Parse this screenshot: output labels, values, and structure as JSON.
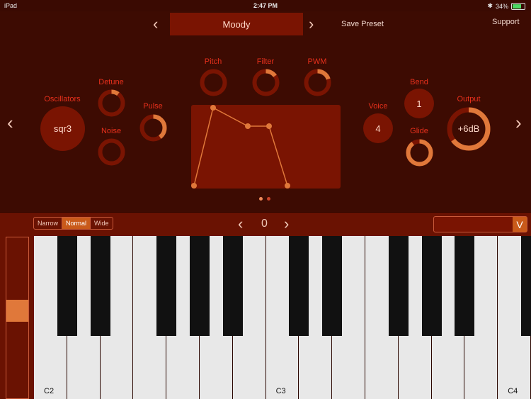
{
  "status": {
    "device": "iPad",
    "time": "2:47 PM",
    "battery": "34%"
  },
  "preset": {
    "name": "Moody",
    "prev_icon": "chevron-left-icon",
    "next_icon": "chevron-right-icon",
    "save_label": "Save Preset"
  },
  "support_label": "Support",
  "controls": {
    "oscillators": {
      "label": "Oscillators",
      "value": "sqr3"
    },
    "detune": {
      "label": "Detune",
      "level": 0.1
    },
    "noise": {
      "label": "Noise",
      "level": 0
    },
    "pulse": {
      "label": "Pulse",
      "level": 0.4
    },
    "pitch": {
      "label": "Pitch",
      "level": 0
    },
    "filter": {
      "label": "Filter",
      "level": 0.15
    },
    "pwm": {
      "label": "PWM",
      "level": 0.2
    },
    "voice": {
      "label": "Voice",
      "value": "4"
    },
    "bend": {
      "label": "Bend",
      "value": "1"
    },
    "glide": {
      "label": "Glide",
      "level": 0.9
    },
    "output": {
      "label": "Output",
      "value": "+6dB",
      "level": 0.65
    }
  },
  "keyboard": {
    "width_modes": [
      "Narrow",
      "Normal",
      "Wide"
    ],
    "selected_mode": "Normal",
    "octave_shift": "0",
    "dropdown_icon": "V",
    "note_labels": [
      "C2",
      "C3",
      "C4"
    ],
    "slider_level": 0.55
  },
  "colors": {
    "accent": "#e0783a",
    "primary": "#e8301c",
    "panel": "#7a1402"
  }
}
